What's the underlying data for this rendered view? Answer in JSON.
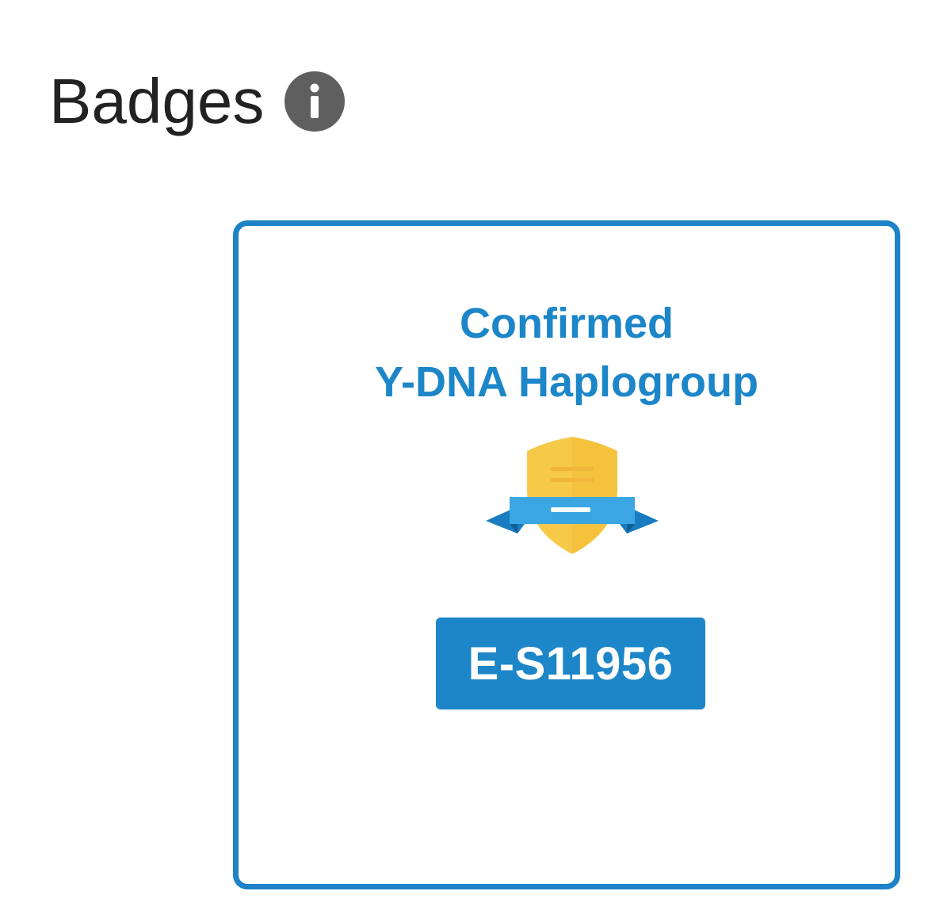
{
  "header": {
    "title": "Badges",
    "info_icon": "info-icon"
  },
  "badge_card": {
    "title_line1": "Confirmed",
    "title_line2": "Y-DNA Haplogroup",
    "icon": "shield-ribbon-icon",
    "haplogroup": "E-S11956"
  },
  "colors": {
    "accent_blue": "#1c86c8",
    "shield_gold": "#f7c948",
    "info_gray": "#5f5f5f"
  }
}
